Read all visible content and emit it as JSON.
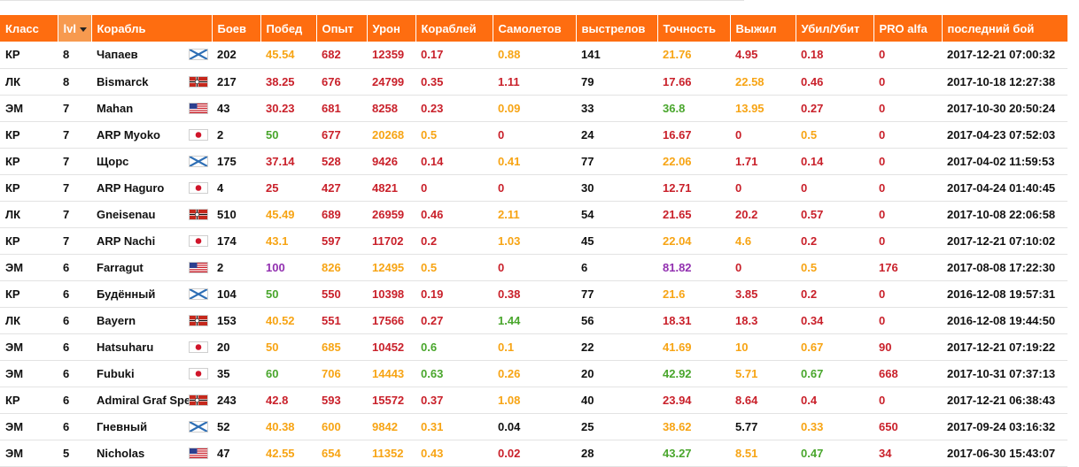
{
  "colors": {
    "header_bg": "#fe6d10",
    "sorted_header_bg": "#f79a4f",
    "red": "#c9202a",
    "orange": "#f7a414",
    "green": "#49a62c",
    "purple": "#9230b0"
  },
  "headers": [
    "Класс",
    "lvl",
    "Корабль",
    "Боев",
    "Побед",
    "Опыт",
    "Урон",
    "Кораблей",
    "Самолетов",
    "выстрелов",
    "Точность",
    "Выжил",
    "Убил/Убит",
    "PRO alfa",
    "последний бой"
  ],
  "sorted_column": "lvl",
  "rows": [
    {
      "cls": "КР",
      "lvl": "8",
      "ship": "Чапаев",
      "flag": "ussr-flag-icon",
      "battles": "202",
      "wins": "45.54",
      "wins_c": "orange",
      "xp": "682",
      "xp_c": "red",
      "dmg": "12359",
      "dmg_c": "red",
      "ships": "0.17",
      "ships_c": "red",
      "planes": "0.88",
      "planes_c": "orange",
      "shots": "141",
      "acc": "21.76",
      "acc_c": "orange",
      "surv": "4.95",
      "surv_c": "red",
      "kd": "0.18",
      "kd_c": "red",
      "pro": "0",
      "pro_c": "red",
      "last": "2017-12-21 07:00:32"
    },
    {
      "cls": "ЛК",
      "lvl": "8",
      "ship": "Bismarck",
      "flag": "germany-flag-icon",
      "battles": "217",
      "wins": "38.25",
      "wins_c": "red",
      "xp": "676",
      "xp_c": "red",
      "dmg": "24799",
      "dmg_c": "red",
      "ships": "0.35",
      "ships_c": "red",
      "planes": "1.11",
      "planes_c": "red",
      "shots": "79",
      "acc": "17.66",
      "acc_c": "red",
      "surv": "22.58",
      "surv_c": "orange",
      "kd": "0.46",
      "kd_c": "red",
      "pro": "0",
      "pro_c": "red",
      "last": "2017-10-18 12:27:38"
    },
    {
      "cls": "ЭМ",
      "lvl": "7",
      "ship": "Mahan",
      "flag": "usa-flag-icon",
      "battles": "43",
      "wins": "30.23",
      "wins_c": "red",
      "xp": "681",
      "xp_c": "red",
      "dmg": "8258",
      "dmg_c": "red",
      "ships": "0.23",
      "ships_c": "red",
      "planes": "0.09",
      "planes_c": "orange",
      "shots": "33",
      "acc": "36.8",
      "acc_c": "green",
      "surv": "13.95",
      "surv_c": "orange",
      "kd": "0.27",
      "kd_c": "red",
      "pro": "0",
      "pro_c": "red",
      "last": "2017-10-30 20:50:24"
    },
    {
      "cls": "КР",
      "lvl": "7",
      "ship": "ARP Myoko",
      "flag": "japan-flag-icon",
      "battles": "2",
      "wins": "50",
      "wins_c": "green",
      "xp": "677",
      "xp_c": "red",
      "dmg": "20268",
      "dmg_c": "orange",
      "ships": "0.5",
      "ships_c": "orange",
      "planes": "0",
      "planes_c": "red",
      "shots": "24",
      "acc": "16.67",
      "acc_c": "red",
      "surv": "0",
      "surv_c": "red",
      "kd": "0.5",
      "kd_c": "orange",
      "pro": "0",
      "pro_c": "red",
      "last": "2017-04-23 07:52:03"
    },
    {
      "cls": "КР",
      "lvl": "7",
      "ship": "Щорс",
      "flag": "ussr-flag-icon",
      "battles": "175",
      "wins": "37.14",
      "wins_c": "red",
      "xp": "528",
      "xp_c": "red",
      "dmg": "9426",
      "dmg_c": "red",
      "ships": "0.14",
      "ships_c": "red",
      "planes": "0.41",
      "planes_c": "orange",
      "shots": "77",
      "acc": "22.06",
      "acc_c": "orange",
      "surv": "1.71",
      "surv_c": "red",
      "kd": "0.14",
      "kd_c": "red",
      "pro": "0",
      "pro_c": "red",
      "last": "2017-04-02 11:59:53"
    },
    {
      "cls": "КР",
      "lvl": "7",
      "ship": "ARP Haguro",
      "flag": "japan-flag-icon",
      "battles": "4",
      "wins": "25",
      "wins_c": "red",
      "xp": "427",
      "xp_c": "red",
      "dmg": "4821",
      "dmg_c": "red",
      "ships": "0",
      "ships_c": "red",
      "planes": "0",
      "planes_c": "red",
      "shots": "30",
      "acc": "12.71",
      "acc_c": "red",
      "surv": "0",
      "surv_c": "red",
      "kd": "0",
      "kd_c": "red",
      "pro": "0",
      "pro_c": "red",
      "last": "2017-04-24 01:40:45"
    },
    {
      "cls": "ЛК",
      "lvl": "7",
      "ship": "Gneisenau",
      "flag": "germany-flag-icon",
      "battles": "510",
      "wins": "45.49",
      "wins_c": "orange",
      "xp": "689",
      "xp_c": "red",
      "dmg": "26959",
      "dmg_c": "red",
      "ships": "0.46",
      "ships_c": "red",
      "planes": "2.11",
      "planes_c": "orange",
      "shots": "54",
      "acc": "21.65",
      "acc_c": "red",
      "surv": "20.2",
      "surv_c": "red",
      "kd": "0.57",
      "kd_c": "red",
      "pro": "0",
      "pro_c": "red",
      "last": "2017-10-08 22:06:58"
    },
    {
      "cls": "КР",
      "lvl": "7",
      "ship": "ARP Nachi",
      "flag": "japan-flag-icon",
      "battles": "174",
      "wins": "43.1",
      "wins_c": "orange",
      "xp": "597",
      "xp_c": "red",
      "dmg": "11702",
      "dmg_c": "red",
      "ships": "0.2",
      "ships_c": "red",
      "planes": "1.03",
      "planes_c": "orange",
      "shots": "45",
      "acc": "22.04",
      "acc_c": "orange",
      "surv": "4.6",
      "surv_c": "orange",
      "kd": "0.2",
      "kd_c": "red",
      "pro": "0",
      "pro_c": "red",
      "last": "2017-12-21 07:10:02"
    },
    {
      "cls": "ЭМ",
      "lvl": "6",
      "ship": "Farragut",
      "flag": "usa-flag-icon",
      "battles": "2",
      "wins": "100",
      "wins_c": "purple",
      "xp": "826",
      "xp_c": "orange",
      "dmg": "12495",
      "dmg_c": "orange",
      "ships": "0.5",
      "ships_c": "orange",
      "planes": "0",
      "planes_c": "red",
      "shots": "6",
      "acc": "81.82",
      "acc_c": "purple",
      "surv": "0",
      "surv_c": "red",
      "kd": "0.5",
      "kd_c": "orange",
      "pro": "176",
      "pro_c": "red",
      "last": "2017-08-08 17:22:30"
    },
    {
      "cls": "КР",
      "lvl": "6",
      "ship": "Будённый",
      "flag": "ussr-flag-icon",
      "battles": "104",
      "wins": "50",
      "wins_c": "green",
      "xp": "550",
      "xp_c": "red",
      "dmg": "10398",
      "dmg_c": "red",
      "ships": "0.19",
      "ships_c": "red",
      "planes": "0.38",
      "planes_c": "red",
      "shots": "77",
      "acc": "21.6",
      "acc_c": "orange",
      "surv": "3.85",
      "surv_c": "red",
      "kd": "0.2",
      "kd_c": "red",
      "pro": "0",
      "pro_c": "red",
      "last": "2016-12-08 19:57:31"
    },
    {
      "cls": "ЛК",
      "lvl": "6",
      "ship": "Bayern",
      "flag": "germany-flag-icon",
      "battles": "153",
      "wins": "40.52",
      "wins_c": "orange",
      "xp": "551",
      "xp_c": "red",
      "dmg": "17566",
      "dmg_c": "red",
      "ships": "0.27",
      "ships_c": "red",
      "planes": "1.44",
      "planes_c": "green",
      "shots": "56",
      "acc": "18.31",
      "acc_c": "red",
      "surv": "18.3",
      "surv_c": "red",
      "kd": "0.34",
      "kd_c": "red",
      "pro": "0",
      "pro_c": "red",
      "last": "2016-12-08 19:44:50"
    },
    {
      "cls": "ЭМ",
      "lvl": "6",
      "ship": "Hatsuharu",
      "flag": "japan-flag-icon",
      "battles": "20",
      "wins": "50",
      "wins_c": "orange",
      "xp": "685",
      "xp_c": "orange",
      "dmg": "10452",
      "dmg_c": "red",
      "ships": "0.6",
      "ships_c": "green",
      "planes": "0.1",
      "planes_c": "orange",
      "shots": "22",
      "acc": "41.69",
      "acc_c": "orange",
      "surv": "10",
      "surv_c": "orange",
      "kd": "0.67",
      "kd_c": "orange",
      "pro": "90",
      "pro_c": "red",
      "last": "2017-12-21 07:19:22"
    },
    {
      "cls": "ЭМ",
      "lvl": "6",
      "ship": "Fubuki",
      "flag": "japan-flag-icon",
      "battles": "35",
      "wins": "60",
      "wins_c": "green",
      "xp": "706",
      "xp_c": "orange",
      "dmg": "14443",
      "dmg_c": "orange",
      "ships": "0.63",
      "ships_c": "green",
      "planes": "0.26",
      "planes_c": "orange",
      "shots": "20",
      "acc": "42.92",
      "acc_c": "green",
      "surv": "5.71",
      "surv_c": "orange",
      "kd": "0.67",
      "kd_c": "green",
      "pro": "668",
      "pro_c": "red",
      "last": "2017-10-31 07:37:13"
    },
    {
      "cls": "КР",
      "lvl": "6",
      "ship": "Admiral Graf Spee",
      "flag": "germany-flag-icon",
      "battles": "243",
      "wins": "42.8",
      "wins_c": "red",
      "xp": "593",
      "xp_c": "red",
      "dmg": "15572",
      "dmg_c": "red",
      "ships": "0.37",
      "ships_c": "red",
      "planes": "1.08",
      "planes_c": "orange",
      "shots": "40",
      "acc": "23.94",
      "acc_c": "red",
      "surv": "8.64",
      "surv_c": "red",
      "kd": "0.4",
      "kd_c": "red",
      "pro": "0",
      "pro_c": "red",
      "last": "2017-12-21 06:38:43"
    },
    {
      "cls": "ЭМ",
      "lvl": "6",
      "ship": "Гневный",
      "flag": "ussr-flag-icon",
      "battles": "52",
      "wins": "40.38",
      "wins_c": "orange",
      "xp": "600",
      "xp_c": "orange",
      "dmg": "9842",
      "dmg_c": "orange",
      "ships": "0.31",
      "ships_c": "orange",
      "planes": "0.04",
      "planes_c": "black",
      "shots": "25",
      "acc": "38.62",
      "acc_c": "orange",
      "surv": "5.77",
      "surv_c": "black",
      "kd": "0.33",
      "kd_c": "orange",
      "pro": "650",
      "pro_c": "red",
      "last": "2017-09-24 03:16:32"
    },
    {
      "cls": "ЭМ",
      "lvl": "5",
      "ship": "Nicholas",
      "flag": "usa-flag-icon",
      "battles": "47",
      "wins": "42.55",
      "wins_c": "orange",
      "xp": "654",
      "xp_c": "orange",
      "dmg": "11352",
      "dmg_c": "orange",
      "ships": "0.43",
      "ships_c": "orange",
      "planes": "0.02",
      "planes_c": "red",
      "shots": "28",
      "acc": "43.27",
      "acc_c": "green",
      "surv": "8.51",
      "surv_c": "orange",
      "kd": "0.47",
      "kd_c": "green",
      "pro": "34",
      "pro_c": "red",
      "last": "2017-06-30 15:43:07"
    }
  ]
}
